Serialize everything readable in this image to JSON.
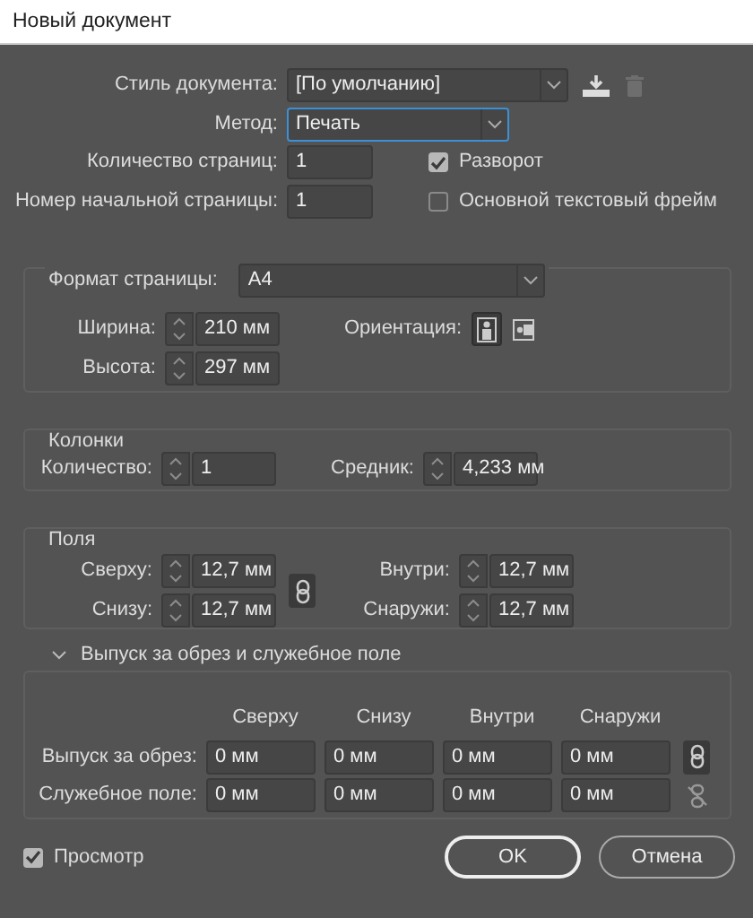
{
  "window": {
    "title": "Новый документ"
  },
  "document_style": {
    "label": "Стиль документа:",
    "value": "[По умолчанию]"
  },
  "intent": {
    "label": "Метод:",
    "value": "Печать",
    "focused": true
  },
  "pages": {
    "label": "Количество страниц:",
    "value": "1"
  },
  "facing_pages": {
    "label": "Разворот",
    "checked": true
  },
  "start_page": {
    "label": "Номер начальной страницы:",
    "value": "1"
  },
  "primary_text_frame": {
    "label": "Основной текстовый фрейм",
    "checked": false
  },
  "page_size": {
    "label": "Формат страницы:",
    "value": "A4",
    "width": {
      "label": "Ширина:",
      "value": "210 мм"
    },
    "height": {
      "label": "Высота:",
      "value": "297 мм"
    },
    "orientation": {
      "label": "Ориентация:",
      "options": [
        {
          "kind": "portrait",
          "selected": true
        },
        {
          "kind": "landscape",
          "selected": false
        }
      ]
    }
  },
  "columns": {
    "title": "Колонки",
    "count": {
      "label": "Количество:",
      "value": "1"
    },
    "gutter": {
      "label": "Средник:",
      "value": "4,233 мм"
    }
  },
  "margins": {
    "title": "Поля",
    "linked": true,
    "fields": [
      {
        "label": "Сверху:",
        "value": "12,7 мм"
      },
      {
        "label": "Внутри:",
        "value": "12,7 мм"
      },
      {
        "label": "Снизу:",
        "value": "12,7 мм"
      },
      {
        "label": "Снаружи:",
        "value": "12,7 мм"
      }
    ]
  },
  "bleed_slug": {
    "title": "Выпуск за обрез и служебное поле",
    "expanded": true,
    "columns": [
      "Сверху",
      "Снизу",
      "Внутри",
      "Снаружи"
    ],
    "rows": [
      {
        "label": "Выпуск за обрез:",
        "values": [
          "0 мм",
          "0 мм",
          "0 мм",
          "0 мм"
        ],
        "linked": true
      },
      {
        "label": "Служебное поле:",
        "values": [
          "0 мм",
          "0 мм",
          "0 мм",
          "0 мм"
        ],
        "linked": false
      }
    ]
  },
  "preview": {
    "label": "Просмотр",
    "checked": true
  },
  "buttons": [
    {
      "label": "OK",
      "default": true
    },
    {
      "label": "Отмена",
      "default": false
    }
  ]
}
